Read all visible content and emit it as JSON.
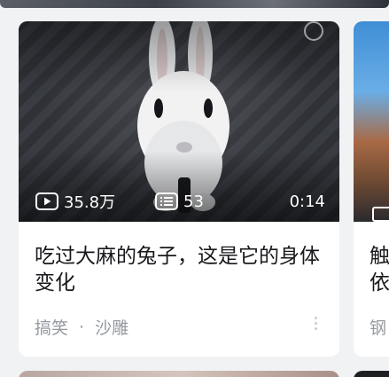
{
  "feed": {
    "card1": {
      "play_count": "35.8万",
      "danmu_count": "53",
      "duration": "0:14",
      "title": "吃过大麻的兔子，这是它的身体变化",
      "tag_category": "搞笑",
      "tag_separator": "·",
      "tag_sub": "沙雕"
    },
    "card2": {
      "title_line1": "触",
      "title_line2": "依",
      "tag": "钢"
    }
  },
  "icons": {
    "play": "play-icon",
    "danmu": "danmu-icon",
    "more": "more-vertical-icon"
  },
  "colors": {
    "background": "#f1f2f3",
    "card": "#ffffff",
    "title_text": "#18191c",
    "tag_text": "#9499a0"
  }
}
